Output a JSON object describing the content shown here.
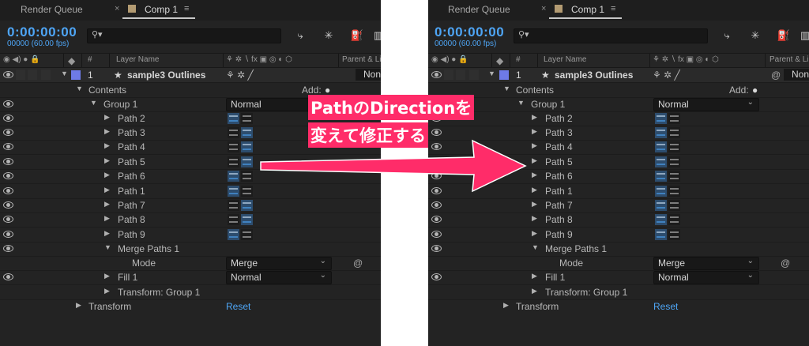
{
  "tabs": {
    "render_queue": "Render Queue",
    "comp": "Comp 1",
    "close": "×",
    "menu": "≡"
  },
  "timecode": "0:00:00:00",
  "fps": "00000 (60.00 fps)",
  "search_icon_glyph": "⚲▾",
  "tools": [
    "⤷",
    "✳",
    "⛽",
    "▥"
  ],
  "columns": {
    "hash": "#",
    "layer_name": "Layer Name",
    "switches": "⚘ ✲ ∖ fx ▣ ◎ ◐ ⬡",
    "parent": "Parent & Link"
  },
  "layer": {
    "index": "1",
    "star": "★",
    "name": "sample3 Outlines",
    "switches": "⚘ ✲ ╱",
    "parent": "None"
  },
  "contents": {
    "label": "Contents",
    "add": "Add:",
    "add_icon": "●"
  },
  "group": {
    "label": "Group 1",
    "blend": "Normal"
  },
  "paths": [
    "Path 2",
    "Path 3",
    "Path 4",
    "Path 5",
    "Path 6",
    "Path 1",
    "Path 7",
    "Path 8",
    "Path 9"
  ],
  "merge": {
    "label": "Merge Paths 1",
    "mode_label": "Mode",
    "mode_value": "Merge",
    "spiral": "@"
  },
  "fill": {
    "label": "Fill 1",
    "blend": "Normal"
  },
  "transform_group": "Transform: Group 1",
  "transform": {
    "label": "Transform",
    "reset": "Reset"
  },
  "annotation": {
    "line1": "PathのDirectionを",
    "line2": "変えて修正する"
  },
  "colors": {
    "accent": "#4ea5f5",
    "annotation": "#ff2c69",
    "label_chip": "#6e7ae6"
  }
}
